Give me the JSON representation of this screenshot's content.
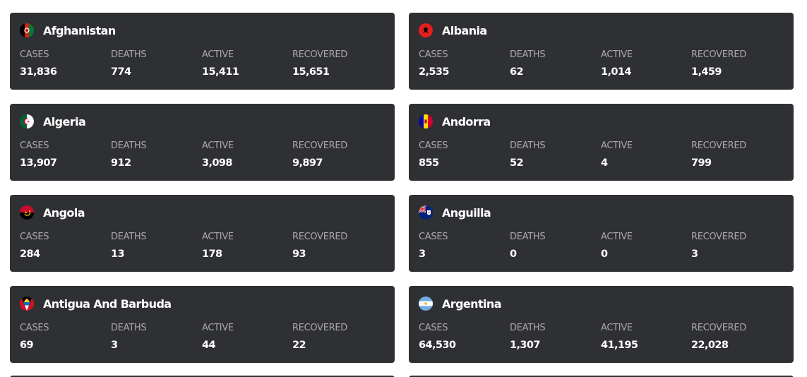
{
  "labels": {
    "cases": "CASES",
    "deaths": "DEATHS",
    "active": "ACTIVE",
    "recovered": "RECOVERED"
  },
  "countries": [
    {
      "name": "Afghanistan",
      "flag_icon": "afghanistan-flag-icon",
      "cases": "31,836",
      "deaths": "774",
      "active": "15,411",
      "recovered": "15,651"
    },
    {
      "name": "Albania",
      "flag_icon": "albania-flag-icon",
      "cases": "2,535",
      "deaths": "62",
      "active": "1,014",
      "recovered": "1,459"
    },
    {
      "name": "Algeria",
      "flag_icon": "algeria-flag-icon",
      "cases": "13,907",
      "deaths": "912",
      "active": "3,098",
      "recovered": "9,897"
    },
    {
      "name": "Andorra",
      "flag_icon": "andorra-flag-icon",
      "cases": "855",
      "deaths": "52",
      "active": "4",
      "recovered": "799"
    },
    {
      "name": "Angola",
      "flag_icon": "angola-flag-icon",
      "cases": "284",
      "deaths": "13",
      "active": "178",
      "recovered": "93"
    },
    {
      "name": "Anguilla",
      "flag_icon": "anguilla-flag-icon",
      "cases": "3",
      "deaths": "0",
      "active": "0",
      "recovered": "3"
    },
    {
      "name": "Antigua And Barbuda",
      "flag_icon": "antigua-and-barbuda-flag-icon",
      "cases": "69",
      "deaths": "3",
      "active": "44",
      "recovered": "22"
    },
    {
      "name": "Argentina",
      "flag_icon": "argentina-flag-icon",
      "cases": "64,530",
      "deaths": "1,307",
      "active": "41,195",
      "recovered": "22,028"
    }
  ],
  "colors": {
    "card_bg": "#2f3033",
    "label": "#a9a9ab",
    "value": "#ffffff",
    "page_bg": "#ffffff"
  }
}
